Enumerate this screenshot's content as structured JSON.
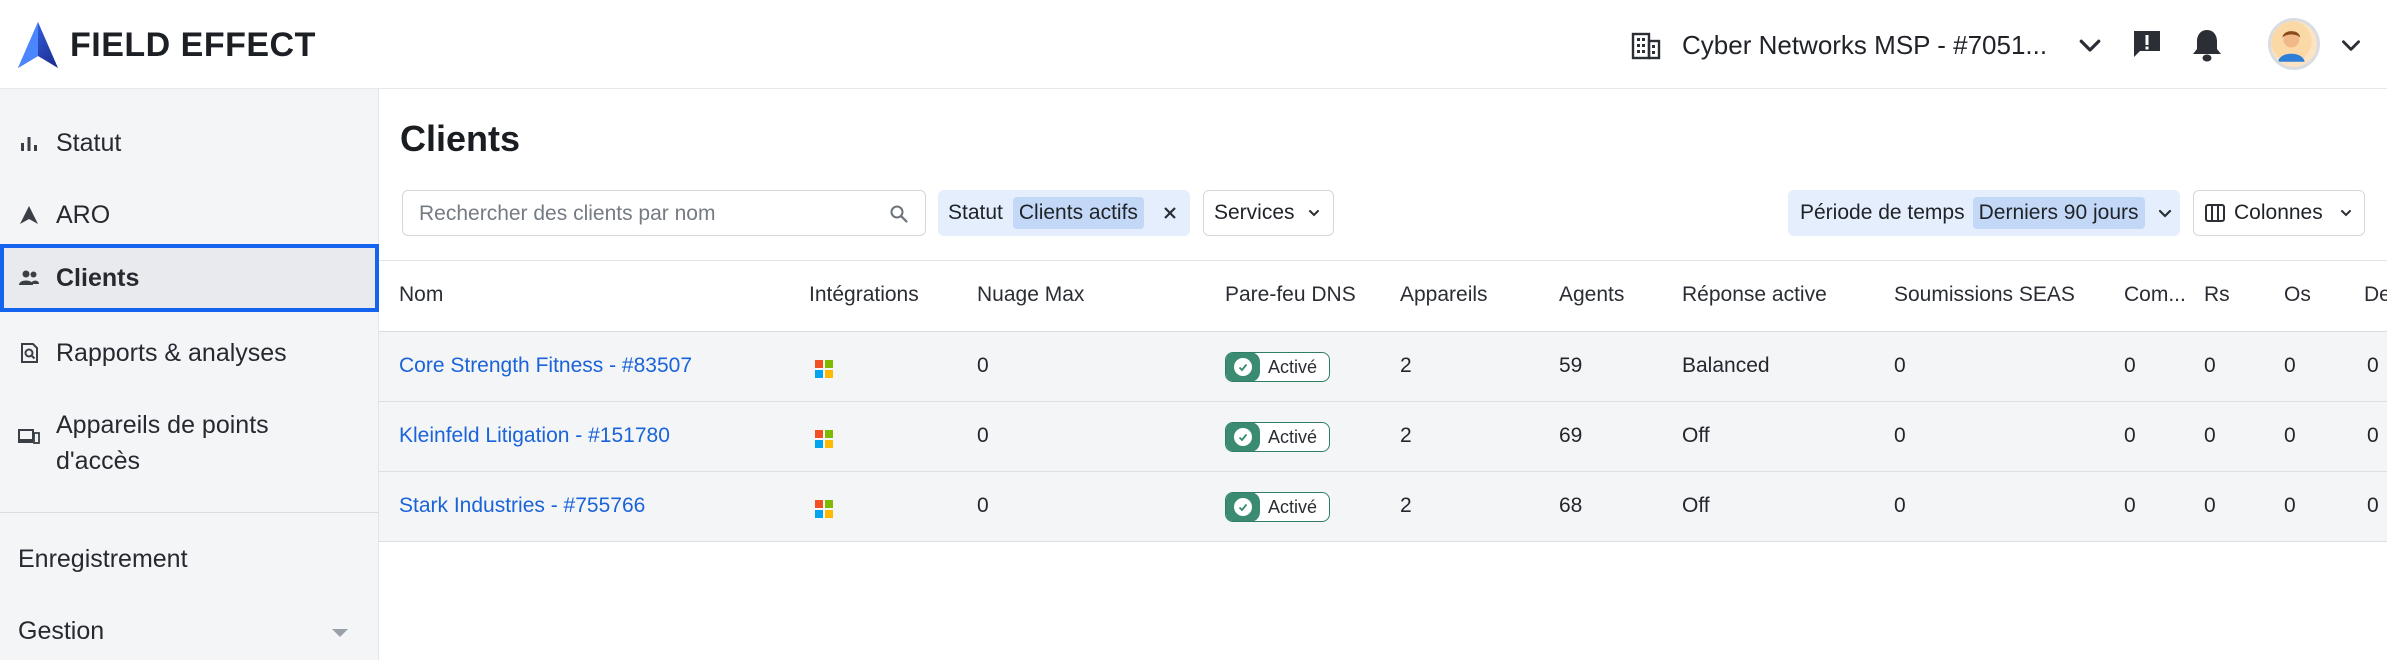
{
  "app": {
    "brand": "FIELD EFFECT"
  },
  "header": {
    "org_name": "Cyber Networks MSP - #7051..."
  },
  "sidebar": {
    "items": [
      {
        "label": "Statut",
        "icon": "bar-chart-icon"
      },
      {
        "label": "ARO",
        "icon": "aro-icon"
      },
      {
        "label": "Clients",
        "icon": "users-icon"
      },
      {
        "label": "Rapports & analyses",
        "icon": "report-search-icon"
      },
      {
        "label": "Appareils de points d'accès",
        "icon": "devices-icon"
      }
    ],
    "sections": [
      {
        "label": "Enregistrement"
      },
      {
        "label": "Gestion"
      }
    ]
  },
  "main": {
    "title": "Clients",
    "search_placeholder": "Rechercher des clients par nom",
    "filters": {
      "status_label": "Statut",
      "status_value": "Clients actifs",
      "services_label": "Services",
      "period_label": "Période de temps",
      "period_value": "Derniers 90 jours",
      "columns_label": "Colonnes"
    },
    "table": {
      "headers": [
        "Nom",
        "Intégrations",
        "Nuage Max",
        "Pare-feu DNS",
        "Appareils",
        "Agents",
        "Réponse active",
        "Soumissions SEAS",
        "Com...",
        "Rs",
        "Os",
        "De"
      ],
      "rows": [
        {
          "name": "Core Strength Fitness - #83507",
          "integration": "microsoft-icon",
          "cloud_max": "0",
          "dns": "Activé",
          "devices": "2",
          "agents": "59",
          "active_response": "Balanced",
          "seas": "0",
          "com": "0",
          "rs": "0",
          "os": "0",
          "de": "0"
        },
        {
          "name": "Kleinfeld Litigation - #151780",
          "integration": "microsoft-icon",
          "cloud_max": "0",
          "dns": "Activé",
          "devices": "2",
          "agents": "69",
          "active_response": "Off",
          "seas": "0",
          "com": "0",
          "rs": "0",
          "os": "0",
          "de": "0"
        },
        {
          "name": "Stark Industries - #755766",
          "integration": "microsoft-icon",
          "cloud_max": "0",
          "dns": "Activé",
          "devices": "2",
          "agents": "68",
          "active_response": "Off",
          "seas": "0",
          "com": "0",
          "rs": "0",
          "os": "0",
          "de": "0"
        }
      ]
    }
  },
  "colors": {
    "accent": "#1464f0",
    "link": "#1a63d8",
    "chip_bg": "#e4eefc",
    "chip_value_bg": "#c3d8f6",
    "badge_green": "#3b8a72",
    "ms_red": "#f25022",
    "ms_green": "#7fba00",
    "ms_blue": "#00a4ef",
    "ms_yellow": "#ffb900"
  }
}
